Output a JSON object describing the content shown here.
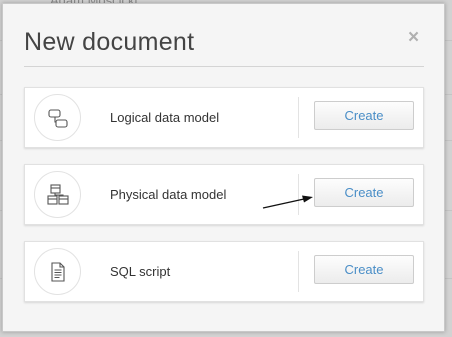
{
  "background": {
    "text": "Adam Moscicki"
  },
  "dialog": {
    "title": "New document",
    "close_glyph": "×"
  },
  "options": [
    {
      "label": "Logical data model",
      "icon": "logical-model-icon",
      "button": "Create"
    },
    {
      "label": "Physical data model",
      "icon": "physical-model-icon",
      "button": "Create"
    },
    {
      "label": "SQL script",
      "icon": "document-icon",
      "button": "Create"
    }
  ],
  "colors": {
    "button_text": "#4a8ec7",
    "title_text": "#444444",
    "close": "#b0b0b0"
  }
}
